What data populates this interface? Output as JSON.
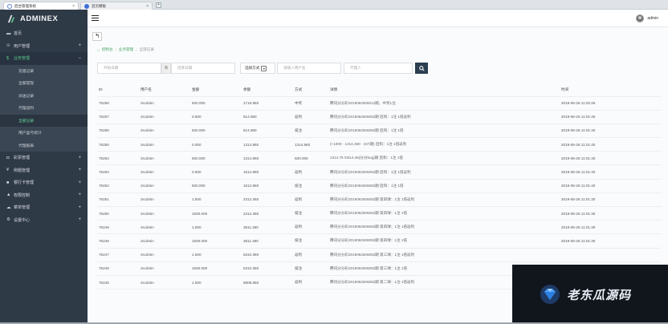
{
  "browser": {
    "tabs": [
      {
        "title": "后台管理系统",
        "close": "×"
      },
      {
        "title": "首页模板",
        "close": "×"
      }
    ],
    "new_tab": "+"
  },
  "sidebar": {
    "brand": "ADMINEX",
    "items": [
      {
        "icon": "▬",
        "label": "首页",
        "arrow": ""
      },
      {
        "icon": "⊙",
        "label": "用户管理",
        "arrow": "+"
      },
      {
        "icon": "$",
        "label": "业务管理",
        "arrow": "−"
      },
      {
        "icon": "◘",
        "label": "彩票管理",
        "arrow": "+"
      },
      {
        "icon": "¥",
        "label": "例题管理",
        "arrow": "+"
      },
      {
        "icon": "■",
        "label": "银行卡管理",
        "arrow": "+"
      },
      {
        "icon": "▲",
        "label": "权限控制",
        "arrow": "+"
      },
      {
        "icon": "☁",
        "label": "菜单管理",
        "arrow": "+"
      },
      {
        "icon": "⚙",
        "label": "设置中心",
        "arrow": "+"
      }
    ],
    "submenu": [
      "充值记录",
      "全部提现",
      "派送记录",
      "代理返利",
      "全部记录",
      "用户盈亏统计",
      "代理报表"
    ]
  },
  "topbar": {
    "username": "admin"
  },
  "content": {
    "back": "↰",
    "breadcrumb": {
      "home_icon": "⌂",
      "home": "控制台",
      "sep": "/",
      "level2": "业务管理",
      "current": "全部记录"
    },
    "filters": {
      "start_placeholder": "开始日期",
      "to": "到",
      "end_placeholder": "结束日期",
      "method_select": "选择方式",
      "caret": "▾",
      "user_placeholder": "请输入用户名",
      "agent_placeholder": "代理人",
      "search_icon": "🔍"
    },
    "table": {
      "headers": [
        "ID",
        "用户名",
        "金额",
        "余额",
        "方式",
        "详情",
        "时间"
      ],
      "rows": [
        [
          "76258",
          "zscdmin",
          "500.000",
          "1716.960",
          "中奖",
          "腾讯分分彩2019062606012期，中奖1注",
          "2019-06-26 11:02:26"
        ],
        [
          "76257",
          "zscdmin",
          "0.500",
          "814.960",
          "返利",
          "腾讯分分彩2019062606082期 后和：1注 1倍返利",
          "2019-06-26 11:01:40"
        ],
        [
          "76256",
          "zscdmin",
          "500.000",
          "814.960",
          "投注",
          "腾讯分分彩2019062606082期 后和：1注 1倍",
          "2019-06-26 11:01:40"
        ],
        [
          "76255",
          "zscdmin",
          "0.000",
          "1314.960",
          "1314.960",
          "(+1000 · 1314.360 · 337期) 后和：1注 1倍返利",
          "2019-06-26 11:01:40"
        ],
        [
          "76254",
          "zscdmin",
          "500.000",
          "1314.960",
          "500.000",
          "1314.76 /0014.46(分分bug)期 后和：1注 1倍",
          "2019-06-26 11:01:40"
        ],
        [
          "76253",
          "zscdmin",
          "0.500",
          "1612.960",
          "返利",
          "腾讯分分彩2019062606082期 后和：1注 1倍返利",
          "2019-06-26 11:01:40"
        ],
        [
          "76252",
          "zscdmin",
          "500.000",
          "1612.960",
          "投注",
          "腾讯分分彩2019062606082期 后和：1注 1倍",
          "2019-06-26 11:01:40"
        ],
        [
          "76251",
          "zscdmin",
          "1.500",
          "2312.360",
          "返利",
          "腾讯分分彩2019062606082期 第四球：1注 1倍返利",
          "2019-06-26 11:01:30"
        ],
        [
          "76250",
          "zscdmin",
          "1500.000",
          "2312.360",
          "投注",
          "腾讯分分彩2019062606082期 第四球：1注 1倍",
          "2019-06-26 11:01:30"
        ],
        [
          "76249",
          "zscdmin",
          "1.500",
          "3811.360",
          "返利",
          "腾讯分分彩2019062606082期 第四球：1注 1倍返利",
          "2019-06-26 11:01:30"
        ],
        [
          "76248",
          "zscdmin",
          "1500.000",
          "3811.360",
          "投注",
          "腾讯分分彩2019062606082期 第四球：1注 1倍",
          "2019-06-26 11:01:30"
        ],
        [
          "76247",
          "zscdmin",
          "1.500",
          "5310.360",
          "返利",
          "腾讯分分彩2019062606082期 第三球：1注 1倍返利",
          ""
        ],
        [
          "76246",
          "zscdmin",
          "1500.000",
          "5310.360",
          "投注",
          "腾讯分分彩2019062606082期 第三球：1注 1倍",
          ""
        ],
        [
          "76245",
          "zscdmin",
          "1.500",
          "6808.860",
          "返利",
          "腾讯分分彩2019062606082期 第二球：1注 1倍返利",
          ""
        ]
      ]
    }
  },
  "watermark": {
    "text": "老东瓜源码"
  }
}
